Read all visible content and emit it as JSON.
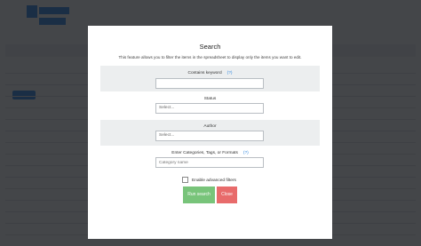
{
  "modal": {
    "title": "Search",
    "description": "This feature allows you to filter the items in the spreadsheet to display only the items you want to edit.",
    "fields": {
      "keyword": {
        "label": "Contains keyword",
        "help": "(?)",
        "value": ""
      },
      "status": {
        "label": "Status",
        "placeholder": "Select..."
      },
      "author": {
        "label": "Author",
        "placeholder": "Select..."
      },
      "taxonomy": {
        "label": "Enter Categories, Tags, or Formats",
        "help": "(?)",
        "placeholder": "Category name"
      }
    },
    "advanced_label": "Enable advanced filters",
    "run_label": "Run search",
    "close_label": "Close"
  },
  "colors": {
    "overlay": "#14161a",
    "run_button": "#78c47a",
    "close_button": "#e86b6b",
    "help_link": "#2e86de"
  }
}
